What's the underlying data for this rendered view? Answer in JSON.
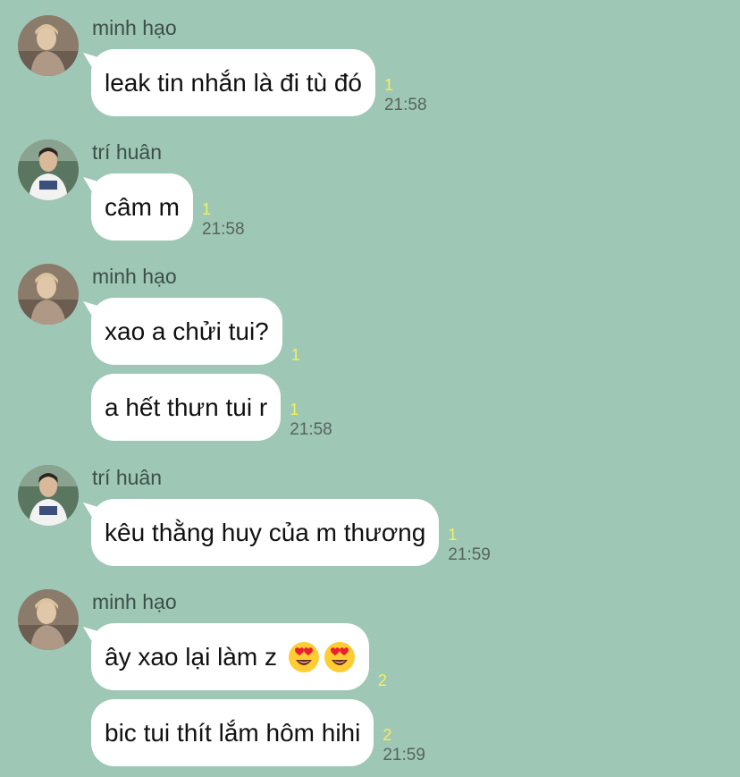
{
  "colors": {
    "background": "#9fc7b5",
    "bubble": "#ffffff",
    "read_count": "#f4f05a",
    "time": "#55655f",
    "sender": "#3c4f49"
  },
  "groups": [
    {
      "sender": "minh hạo",
      "avatar": "avatar-minh-hao",
      "messages": [
        {
          "text": "leak tin nhắn là đi tù đó",
          "read": "1",
          "time": "21:58"
        }
      ]
    },
    {
      "sender": "trí huân",
      "avatar": "avatar-tri-huan",
      "messages": [
        {
          "text": "câm m",
          "read": "1",
          "time": "21:58"
        }
      ]
    },
    {
      "sender": "minh hạo",
      "avatar": "avatar-minh-hao",
      "messages": [
        {
          "text": "xao a chửi tui?",
          "read": "1",
          "time": ""
        },
        {
          "text": "a hết thưn tui r",
          "read": "1",
          "time": "21:58"
        }
      ]
    },
    {
      "sender": "trí huân",
      "avatar": "avatar-tri-huan",
      "messages": [
        {
          "text": "kêu thằng huy của m thương",
          "read": "1",
          "time": "21:59"
        }
      ]
    },
    {
      "sender": "minh hạo",
      "avatar": "avatar-minh-hao",
      "messages": [
        {
          "text": "ây xao lại làm z",
          "emoji": [
            "heart-eyes-emoji",
            "heart-eyes-emoji"
          ],
          "read": "2",
          "time": ""
        },
        {
          "text": "bic tui thít lắm hôm hihi",
          "read": "2",
          "time": "21:59"
        }
      ]
    }
  ]
}
